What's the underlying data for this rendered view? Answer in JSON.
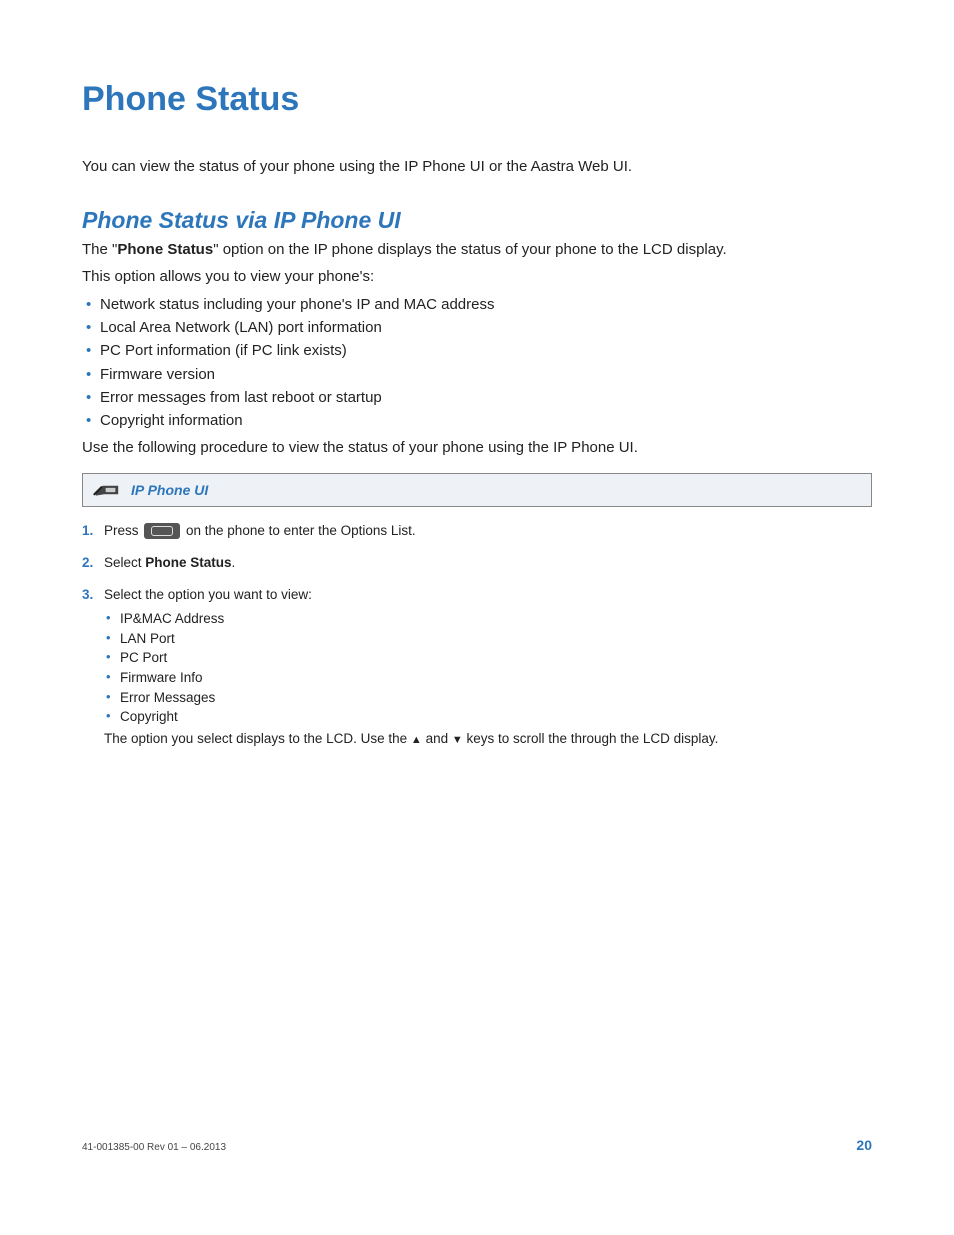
{
  "title": "Phone Status",
  "intro": "You can view the status of your phone using the IP Phone UI or the Aastra Web UI.",
  "section": {
    "heading": "Phone Status via IP Phone UI",
    "p1_pre": "The \"",
    "p1_bold": "Phone Status",
    "p1_post": "\" option on the IP phone displays the status of your phone to the LCD display.",
    "p2": "This option allows you to view your phone's:",
    "features": [
      "Network status including your phone's IP and MAC address",
      "Local Area Network (LAN) port information",
      "PC Port information (if PC link exists)",
      "Firmware version",
      "Error messages from last reboot or startup",
      "Copyright information"
    ],
    "p3": "Use the following procedure to view the status of your phone using the IP Phone UI."
  },
  "callout_label": "IP Phone UI",
  "steps": {
    "s1_pre": "Press ",
    "s1_post": " on the phone to enter the Options List.",
    "s2_pre": "Select ",
    "s2_bold": "Phone Status",
    "s2_post": ".",
    "s3_intro": "Select the option you want to view:",
    "s3_items": [
      "IP&MAC Address",
      "LAN Port",
      "PC Port",
      "Firmware Info",
      "Error Messages",
      "Copyright"
    ],
    "s3_tail_a": "The option you select displays to the LCD. Use the ",
    "s3_tail_b": " and ",
    "s3_tail_c": " keys to scroll the through the LCD display."
  },
  "footer": {
    "rev": "41-001385-00 Rev 01 – 06.2013",
    "page": "20"
  }
}
